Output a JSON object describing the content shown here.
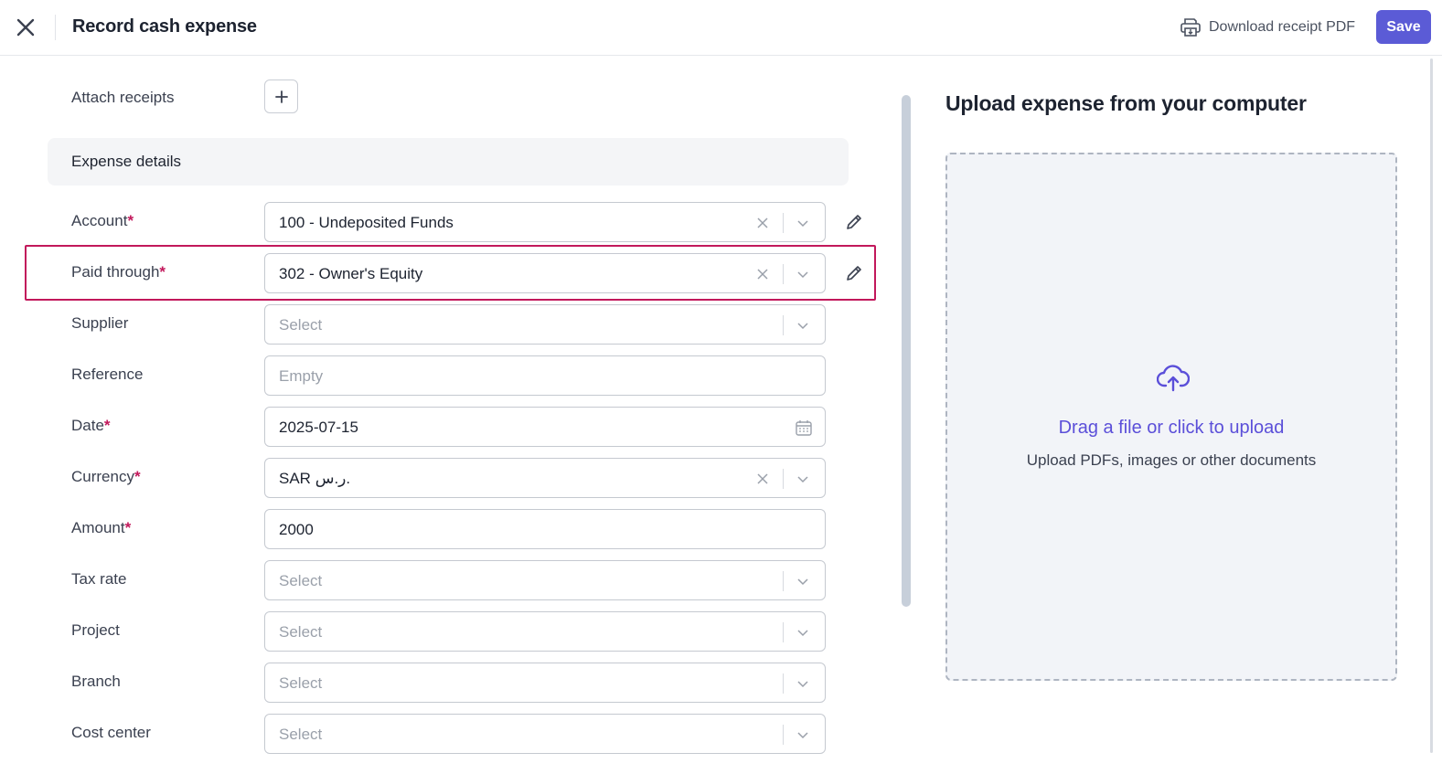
{
  "header": {
    "title": "Record cash expense",
    "download_label": "Download receipt PDF",
    "save_label": "Save"
  },
  "attach": {
    "label": "Attach receipts"
  },
  "section": {
    "title": "Expense details"
  },
  "fields": {
    "account": {
      "label": "Account",
      "required": "*",
      "value": "100 - Undeposited Funds"
    },
    "paid_through": {
      "label": "Paid through",
      "required": "*",
      "value": "302 - Owner's Equity"
    },
    "supplier": {
      "label": "Supplier",
      "placeholder": "Select"
    },
    "reference": {
      "label": "Reference",
      "placeholder": "Empty"
    },
    "date": {
      "label": "Date",
      "required": "*",
      "value": "2025-07-15"
    },
    "currency": {
      "label": "Currency",
      "required": "*",
      "value": "SAR ر.س."
    },
    "amount": {
      "label": "Amount",
      "required": "*",
      "value": "2000"
    },
    "tax_rate": {
      "label": "Tax rate",
      "placeholder": "Select"
    },
    "project": {
      "label": "Project",
      "placeholder": "Select"
    },
    "branch": {
      "label": "Branch",
      "placeholder": "Select"
    },
    "cost_center": {
      "label": "Cost center",
      "placeholder": "Select"
    }
  },
  "upload": {
    "title": "Upload expense from your computer",
    "link": "Drag a file or click to upload",
    "hint": "Upload PDFs, images or other documents"
  },
  "colors": {
    "accent": "#5b5bd6",
    "highlight": "#c2185b",
    "link": "#5b4fd9"
  },
  "icons": {
    "close": "close-icon",
    "printer": "printer-icon",
    "plus": "plus-icon",
    "clear": "clear-icon",
    "chevron": "chevron-down-icon",
    "edit": "pencil-icon",
    "calendar": "calendar-icon",
    "upload": "cloud-upload-icon"
  }
}
